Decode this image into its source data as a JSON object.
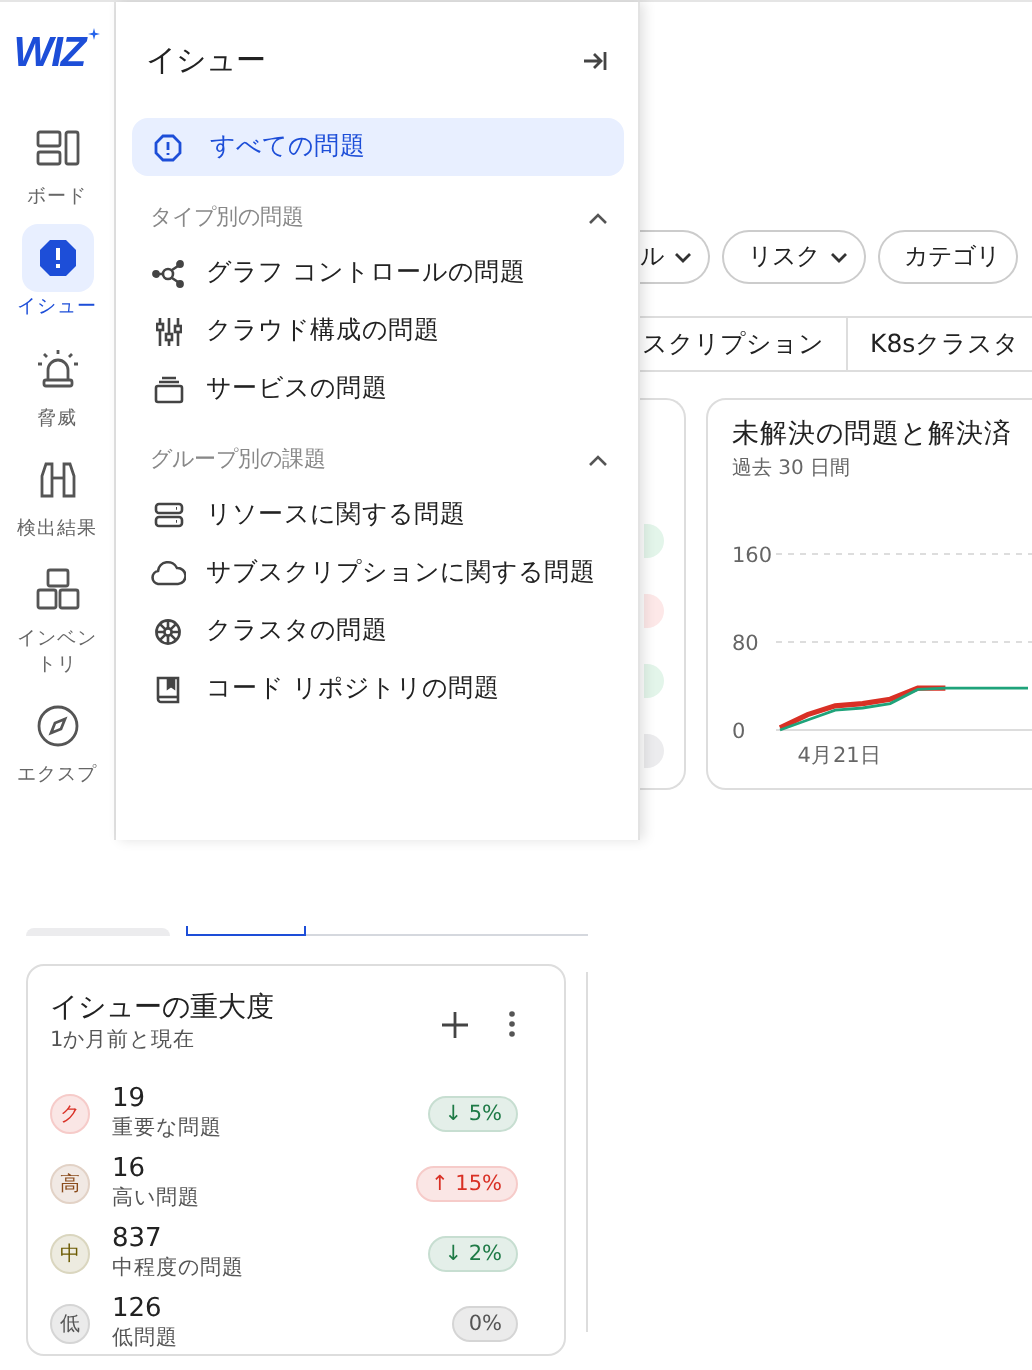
{
  "logo": {
    "text": "WIZ"
  },
  "rail": {
    "items": [
      {
        "label": "ボード",
        "selected": false
      },
      {
        "label": "イシュー",
        "selected": true
      },
      {
        "label": "脅威",
        "selected": false
      },
      {
        "label": "検出結果",
        "selected": false
      },
      {
        "label": "インベントリ",
        "selected": false
      },
      {
        "label": "エクスプ",
        "selected": false
      }
    ]
  },
  "flyout": {
    "title": "イシュー",
    "top_item": {
      "label": "すべての問題",
      "selected": true
    },
    "groups": [
      {
        "title": "タイプ別の問題",
        "expanded": true,
        "items": [
          {
            "label": "グラフ コントロールの問題"
          },
          {
            "label": "クラウド構成の問題"
          },
          {
            "label": "サービスの問題"
          }
        ]
      },
      {
        "title": "グループ別の課題",
        "expanded": true,
        "items": [
          {
            "label": "リソースに関する問題"
          },
          {
            "label": "サブスクリプションに関する問題"
          },
          {
            "label": "クラスタの問題"
          },
          {
            "label": "コード リポジトリの問題"
          }
        ]
      }
    ]
  },
  "filters": [
    {
      "label": "ル"
    },
    {
      "label": "リスク"
    },
    {
      "label": "カテゴリ"
    }
  ],
  "group_tabs": [
    {
      "label": "スクリプション"
    },
    {
      "label": "K8sクラスタ"
    }
  ],
  "side_badges": [
    {
      "color": "#e3f5ea"
    },
    {
      "color": "#fde8e8"
    },
    {
      "color": "#e3f5ea"
    },
    {
      "color": "#ececee"
    }
  ],
  "chart_card": {
    "title": "未解決の問題と解決済",
    "subtitle": "過去 30 日間",
    "chart_data": {
      "type": "line",
      "ylim": [
        0,
        160
      ],
      "yticks": [
        {
          "value": 0,
          "label": "0"
        },
        {
          "value": 80,
          "label": "80"
        },
        {
          "value": 160,
          "label": "160"
        }
      ],
      "annotations": [
        "4月21日"
      ],
      "series": [
        {
          "color": "#d93025",
          "values": [
            2,
            14,
            22,
            24,
            28,
            38,
            38,
            null,
            null,
            null
          ]
        },
        {
          "color": "#1fa37a",
          "values": [
            0,
            9,
            18,
            20,
            24,
            37,
            38,
            38,
            38,
            38
          ]
        }
      ]
    }
  },
  "severity_card": {
    "title": "イシューの重大度",
    "subtitle": "1か月前と現在",
    "rows": [
      {
        "mark": "ク",
        "color": "#d93025",
        "count": "19",
        "label": "重要な問題",
        "change": {
          "arrow": "↓",
          "text": "5%",
          "color": "#1e7a46"
        }
      },
      {
        "mark": "高",
        "color": "#8a4b1b",
        "count": "16",
        "label": "高い問題",
        "change": {
          "arrow": "↑",
          "text": "15%",
          "color": "#d93025"
        }
      },
      {
        "mark": "中",
        "color": "#6b5a00",
        "count": "837",
        "label": "中程度の問題",
        "change": {
          "arrow": "↓",
          "text": "2%",
          "color": "#1e7a46"
        }
      },
      {
        "mark": "低",
        "color": "#555555",
        "count": "126",
        "label": "低問題",
        "change": {
          "text": "0%",
          "color": "#555555"
        }
      }
    ]
  }
}
